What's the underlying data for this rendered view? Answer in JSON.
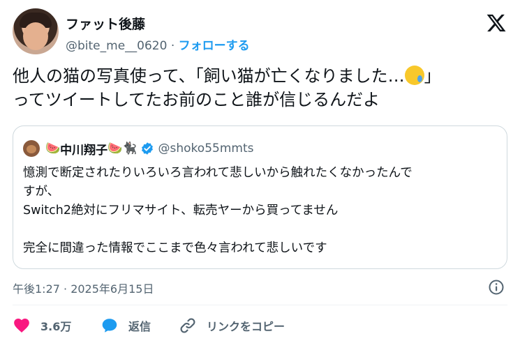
{
  "author": {
    "name": "ファット後藤",
    "handle": "@bite_me__0620",
    "separator": "·",
    "follow_label": "フォローする"
  },
  "tweet": {
    "text_line1": "他人の猫の写真使って、「飼い猫が亡くなりました…",
    "text_line1_end": "」",
    "text_line2": "ってツイートしてたお前のこと誰が信じるんだよ",
    "emoji": "smiling-face-with-tear"
  },
  "quote": {
    "name_prefix": "🍉",
    "name": "中川翔子",
    "name_suffix": "🍉🐈‍⬛",
    "handle": "@shoko55mmts",
    "body": "憶測で断定されたりいろいろ言われて悲しいから触れたくなかったんで\nすが、\nSwitch2絶対にフリマサイト、転売ヤーから買ってません\n\n完全に間違った情報でここまで色々言われて悲しいです"
  },
  "meta": {
    "timestamp": "午後1:27 · 2025年6月15日"
  },
  "actions": {
    "like_count": "3.6万",
    "reply_label": "返信",
    "copy_link_label": "リンクをコピー"
  },
  "colors": {
    "accent": "#1d9bf0",
    "like": "#f91880",
    "secondary_text": "#536471",
    "border": "#cfd9de"
  }
}
